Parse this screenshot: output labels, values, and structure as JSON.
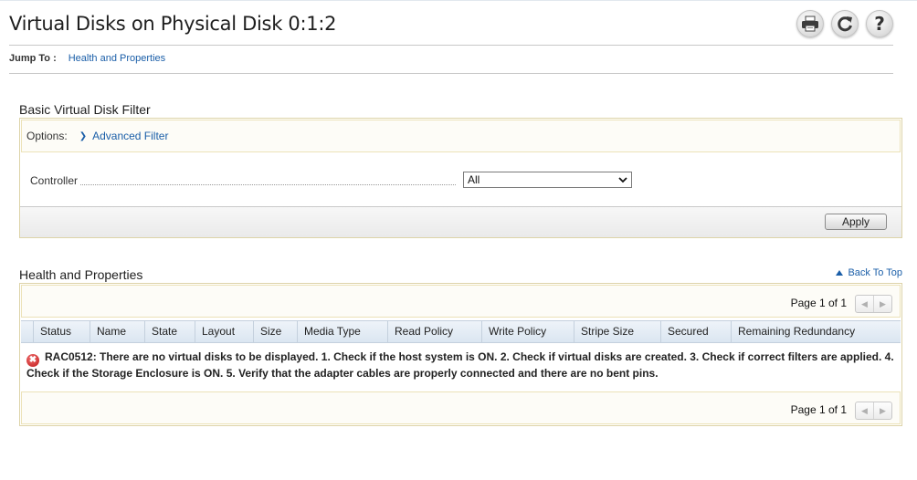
{
  "page": {
    "title": "Virtual Disks on Physical Disk 0:1:2"
  },
  "toolbar": {
    "print_icon": "printer-icon",
    "refresh_icon": "refresh-icon",
    "help_icon": "help-icon",
    "help_glyph": "?"
  },
  "jump": {
    "label": "Jump To :",
    "link": "Health and Properties"
  },
  "filter": {
    "title": "Basic Virtual Disk Filter",
    "options_label": "Options:",
    "advanced_link": "Advanced Filter",
    "controller_label": "Controller",
    "controller_value": "All",
    "apply_label": "Apply"
  },
  "health": {
    "title": "Health and Properties",
    "back_to_top": "Back To Top",
    "page_top": "Page 1 of 1",
    "page_bottom": "Page 1 of 1",
    "columns": [
      "Status",
      "Name",
      "State",
      "Layout",
      "Size",
      "Media Type",
      "Read Policy",
      "Write Policy",
      "Stripe Size",
      "Secured",
      "Remaining Redundancy"
    ],
    "message": "RAC0512: There are no virtual disks to be displayed.  1. Check if the host system is ON. 2. Check if virtual disks are created. 3. Check if correct filters are applied. 4. Check if the Storage Enclosure is ON. 5. Verify that the adapter cables are properly connected and there are no bent pins."
  },
  "colors": {
    "link": "#1a5ea8",
    "panel_border": "#ddd3a8",
    "header_bg": "#dbe6f1",
    "error": "#c01818"
  }
}
